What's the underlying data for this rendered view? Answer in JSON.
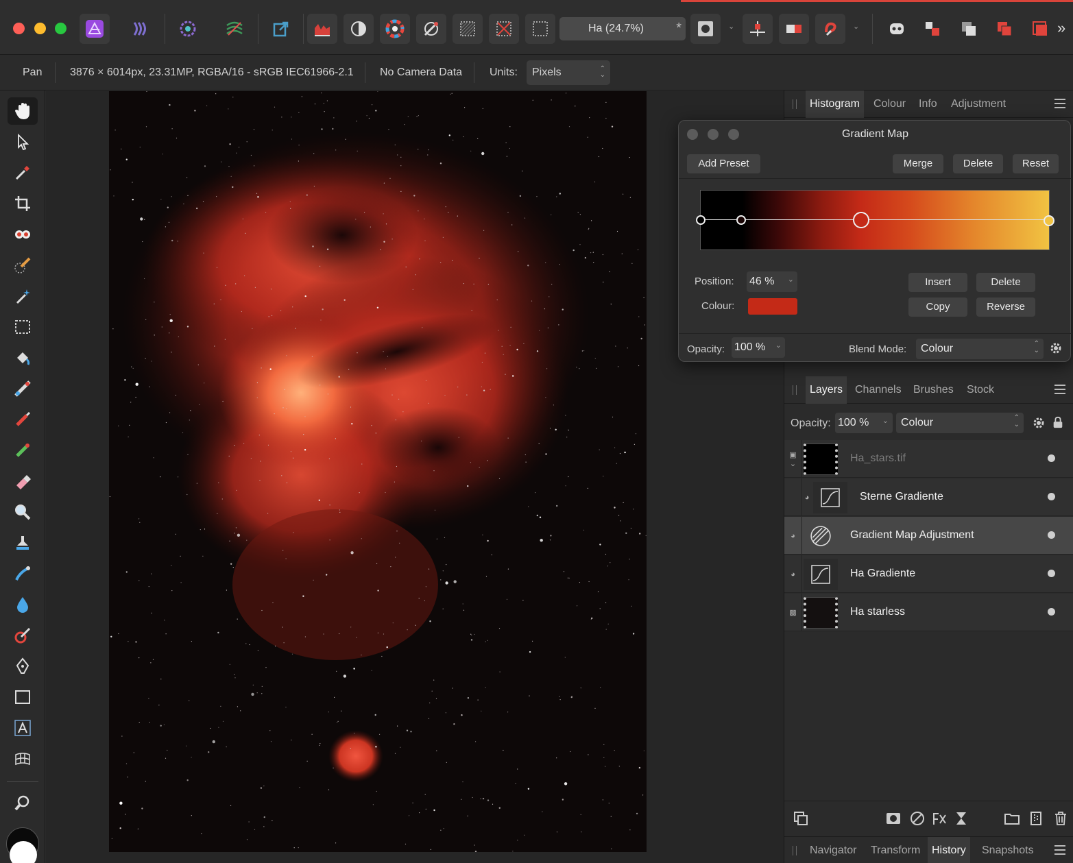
{
  "toolbar": {
    "document_tab": "Ha (24.7%)",
    "document_close": "*",
    "overflow": "»",
    "icons": [
      "app-logo-icon",
      "develop-persona-icon",
      "tone-mapping-persona-icon",
      "liquify-persona-icon",
      "export-persona-icon",
      "histogram-icon",
      "auto-contrast-icon",
      "colour-wheel-icon",
      "white-balance-icon",
      "selection-mode-icon",
      "deselect-icon",
      "marquee-icon",
      "quick-mask-icon",
      "snapping-icon",
      "align-icon",
      "order-icon",
      "assistant-icon",
      "arrange-icon"
    ],
    "accent_color": "#d9443a"
  },
  "context": {
    "tool": "Pan",
    "doc_info": "3876 × 6014px, 23.31MP, RGBA/16 - sRGB IEC61966-2.1",
    "camera": "No Camera Data",
    "units_label": "Units:",
    "units_value": "Pixels"
  },
  "tools": [
    "hand-tool-icon",
    "move-tool-icon",
    "colour-picker-icon",
    "crop-tool-icon",
    "red-eye-icon",
    "selection-brush-icon",
    "magic-wand-icon",
    "marquee-selection-icon",
    "flood-fill-icon",
    "gradient-tool-icon",
    "paint-brush-icon",
    "colour-replacement-icon",
    "erase-tool-icon",
    "zoom-dodge-icon",
    "clone-tool-icon",
    "smudge-tool-icon",
    "blur-tool-icon",
    "retouch-brush-icon",
    "pen-tool-icon",
    "rectangle-tool-icon",
    "text-tool-icon",
    "mesh-warp-icon",
    "zoom-tool-icon"
  ],
  "top_panel": {
    "tabs": [
      "Histogram",
      "Colour",
      "Info",
      "Adjustment"
    ],
    "active": "Histogram"
  },
  "gradient_dialog": {
    "title": "Gradient Map",
    "add_preset": "Add Preset",
    "merge": "Merge",
    "delete": "Delete",
    "reset": "Reset",
    "position_label": "Position:",
    "position_value": "46 %",
    "position_fraction": 0.46,
    "colour_label": "Colour:",
    "colour_value": "#c42a17",
    "insert": "Insert",
    "stop_delete": "Delete",
    "copy": "Copy",
    "reverse": "Reverse",
    "opacity_label": "Opacity:",
    "opacity_value": "100 %",
    "blend_label": "Blend Mode:",
    "blend_value": "Colour"
  },
  "layers_panel": {
    "tabs": [
      "Layers",
      "Channels",
      "Brushes",
      "Stock"
    ],
    "active": "Layers",
    "opacity_label": "Opacity:",
    "opacity_value": "100 %",
    "blend_value": "Colour",
    "layers": [
      {
        "name": "Ha_stars.tif",
        "dim": true
      },
      {
        "name": "Sterne Gradiente",
        "dim": false
      },
      {
        "name": "Gradient Map Adjustment",
        "dim": false,
        "selected": true
      },
      {
        "name": "Ha Gradiente",
        "dim": false
      },
      {
        "name": "Ha starless",
        "dim": false
      }
    ]
  },
  "bottom_panel": {
    "tabs": [
      "Navigator",
      "Transform",
      "History",
      "Snapshots"
    ],
    "active": "History"
  }
}
